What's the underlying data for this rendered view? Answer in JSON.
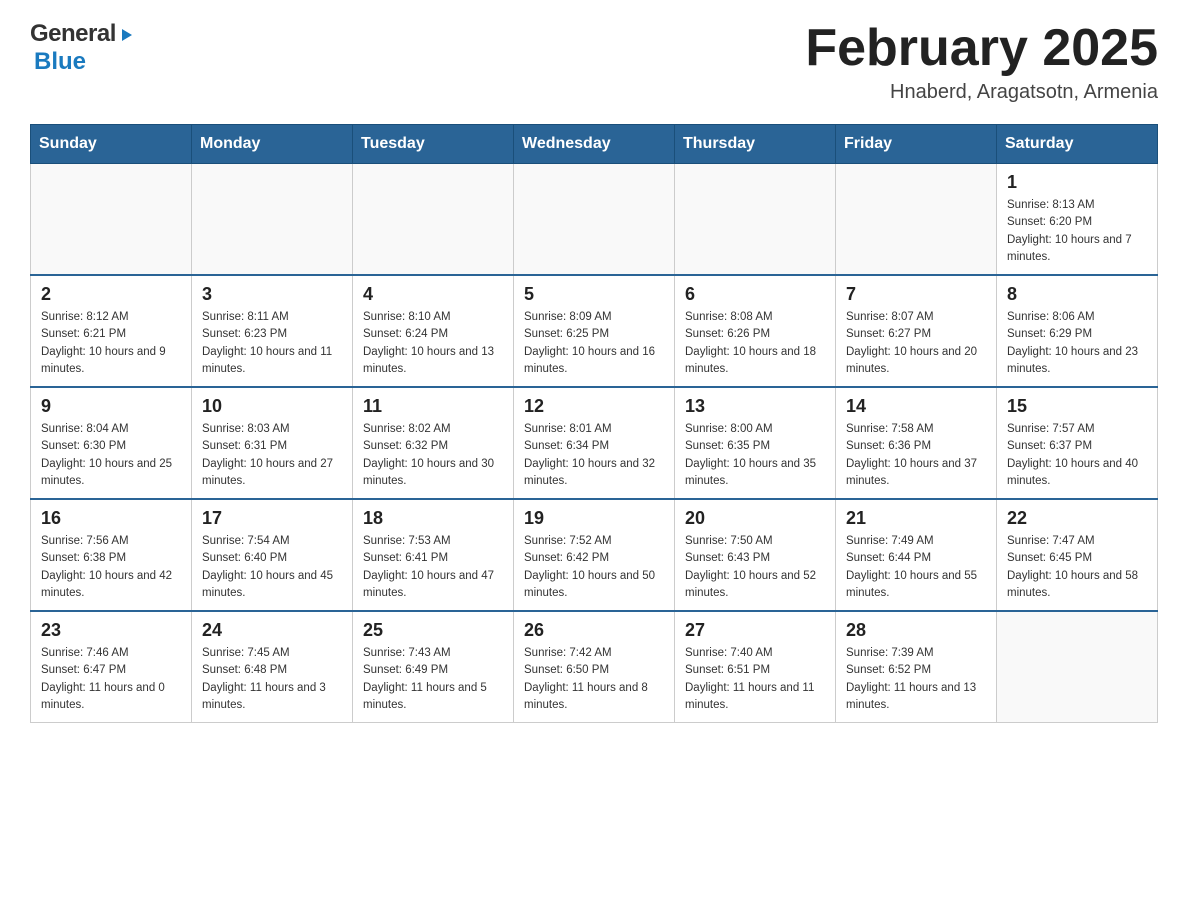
{
  "header": {
    "logo": {
      "general": "General",
      "blue": "Blue"
    },
    "title": "February 2025",
    "location": "Hnaberd, Aragatsotn, Armenia"
  },
  "days_of_week": [
    "Sunday",
    "Monday",
    "Tuesday",
    "Wednesday",
    "Thursday",
    "Friday",
    "Saturday"
  ],
  "weeks": [
    {
      "days": [
        {
          "number": "",
          "info": ""
        },
        {
          "number": "",
          "info": ""
        },
        {
          "number": "",
          "info": ""
        },
        {
          "number": "",
          "info": ""
        },
        {
          "number": "",
          "info": ""
        },
        {
          "number": "",
          "info": ""
        },
        {
          "number": "1",
          "info": "Sunrise: 8:13 AM\nSunset: 6:20 PM\nDaylight: 10 hours and 7 minutes."
        }
      ]
    },
    {
      "days": [
        {
          "number": "2",
          "info": "Sunrise: 8:12 AM\nSunset: 6:21 PM\nDaylight: 10 hours and 9 minutes."
        },
        {
          "number": "3",
          "info": "Sunrise: 8:11 AM\nSunset: 6:23 PM\nDaylight: 10 hours and 11 minutes."
        },
        {
          "number": "4",
          "info": "Sunrise: 8:10 AM\nSunset: 6:24 PM\nDaylight: 10 hours and 13 minutes."
        },
        {
          "number": "5",
          "info": "Sunrise: 8:09 AM\nSunset: 6:25 PM\nDaylight: 10 hours and 16 minutes."
        },
        {
          "number": "6",
          "info": "Sunrise: 8:08 AM\nSunset: 6:26 PM\nDaylight: 10 hours and 18 minutes."
        },
        {
          "number": "7",
          "info": "Sunrise: 8:07 AM\nSunset: 6:27 PM\nDaylight: 10 hours and 20 minutes."
        },
        {
          "number": "8",
          "info": "Sunrise: 8:06 AM\nSunset: 6:29 PM\nDaylight: 10 hours and 23 minutes."
        }
      ]
    },
    {
      "days": [
        {
          "number": "9",
          "info": "Sunrise: 8:04 AM\nSunset: 6:30 PM\nDaylight: 10 hours and 25 minutes."
        },
        {
          "number": "10",
          "info": "Sunrise: 8:03 AM\nSunset: 6:31 PM\nDaylight: 10 hours and 27 minutes."
        },
        {
          "number": "11",
          "info": "Sunrise: 8:02 AM\nSunset: 6:32 PM\nDaylight: 10 hours and 30 minutes."
        },
        {
          "number": "12",
          "info": "Sunrise: 8:01 AM\nSunset: 6:34 PM\nDaylight: 10 hours and 32 minutes."
        },
        {
          "number": "13",
          "info": "Sunrise: 8:00 AM\nSunset: 6:35 PM\nDaylight: 10 hours and 35 minutes."
        },
        {
          "number": "14",
          "info": "Sunrise: 7:58 AM\nSunset: 6:36 PM\nDaylight: 10 hours and 37 minutes."
        },
        {
          "number": "15",
          "info": "Sunrise: 7:57 AM\nSunset: 6:37 PM\nDaylight: 10 hours and 40 minutes."
        }
      ]
    },
    {
      "days": [
        {
          "number": "16",
          "info": "Sunrise: 7:56 AM\nSunset: 6:38 PM\nDaylight: 10 hours and 42 minutes."
        },
        {
          "number": "17",
          "info": "Sunrise: 7:54 AM\nSunset: 6:40 PM\nDaylight: 10 hours and 45 minutes."
        },
        {
          "number": "18",
          "info": "Sunrise: 7:53 AM\nSunset: 6:41 PM\nDaylight: 10 hours and 47 minutes."
        },
        {
          "number": "19",
          "info": "Sunrise: 7:52 AM\nSunset: 6:42 PM\nDaylight: 10 hours and 50 minutes."
        },
        {
          "number": "20",
          "info": "Sunrise: 7:50 AM\nSunset: 6:43 PM\nDaylight: 10 hours and 52 minutes."
        },
        {
          "number": "21",
          "info": "Sunrise: 7:49 AM\nSunset: 6:44 PM\nDaylight: 10 hours and 55 minutes."
        },
        {
          "number": "22",
          "info": "Sunrise: 7:47 AM\nSunset: 6:45 PM\nDaylight: 10 hours and 58 minutes."
        }
      ]
    },
    {
      "days": [
        {
          "number": "23",
          "info": "Sunrise: 7:46 AM\nSunset: 6:47 PM\nDaylight: 11 hours and 0 minutes."
        },
        {
          "number": "24",
          "info": "Sunrise: 7:45 AM\nSunset: 6:48 PM\nDaylight: 11 hours and 3 minutes."
        },
        {
          "number": "25",
          "info": "Sunrise: 7:43 AM\nSunset: 6:49 PM\nDaylight: 11 hours and 5 minutes."
        },
        {
          "number": "26",
          "info": "Sunrise: 7:42 AM\nSunset: 6:50 PM\nDaylight: 11 hours and 8 minutes."
        },
        {
          "number": "27",
          "info": "Sunrise: 7:40 AM\nSunset: 6:51 PM\nDaylight: 11 hours and 11 minutes."
        },
        {
          "number": "28",
          "info": "Sunrise: 7:39 AM\nSunset: 6:52 PM\nDaylight: 11 hours and 13 minutes."
        },
        {
          "number": "",
          "info": ""
        }
      ]
    }
  ]
}
